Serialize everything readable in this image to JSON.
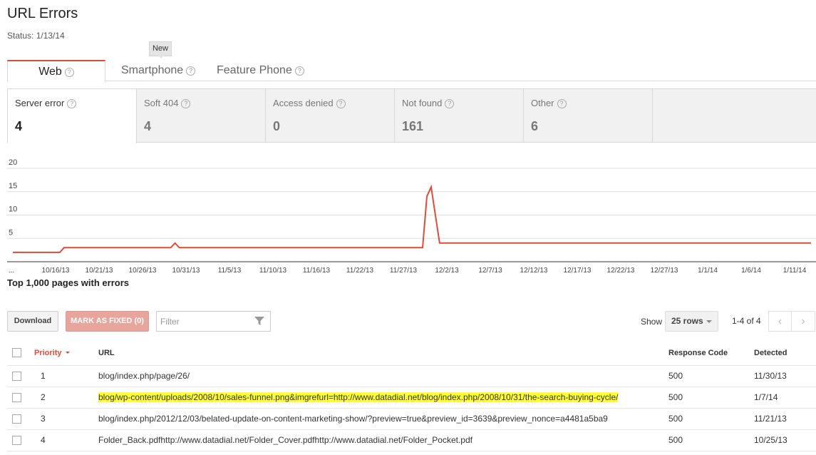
{
  "header": {
    "title": "URL Errors",
    "status": "Status: 1/13/14",
    "new_badge": "New"
  },
  "device_tabs": [
    {
      "label": "Web",
      "active": true
    },
    {
      "label": "Smartphone",
      "active": false
    },
    {
      "label": "Feature Phone",
      "active": false
    }
  ],
  "help_glyph": "?",
  "error_types": [
    {
      "label": "Server error",
      "count": "4",
      "active": true
    },
    {
      "label": "Soft 404",
      "count": "4",
      "active": false
    },
    {
      "label": "Access denied",
      "count": "0",
      "active": false
    },
    {
      "label": "Not found",
      "count": "161",
      "active": false
    },
    {
      "label": "Other",
      "count": "6",
      "active": false
    }
  ],
  "chart_data": {
    "type": "line",
    "y_ticks": [
      5,
      10,
      15,
      20
    ],
    "ylim": [
      0,
      20
    ],
    "x_tick_labels": [
      "...",
      "10/16/13",
      "10/21/13",
      "10/26/13",
      "10/31/13",
      "11/5/13",
      "11/10/13",
      "11/16/13",
      "11/22/13",
      "11/27/13",
      "12/2/13",
      "12/7/13",
      "12/12/13",
      "12/17/13",
      "12/22/13",
      "12/27/13",
      "1/1/14",
      "1/6/14",
      "1/11/14"
    ],
    "series": [
      {
        "color": "#dd4b39",
        "values": [
          2,
          2,
          2,
          2,
          2,
          2,
          2,
          2,
          2,
          2,
          2,
          2,
          3,
          3,
          3,
          3,
          3,
          3,
          3,
          3,
          3,
          3,
          3,
          3,
          3,
          3,
          3,
          3,
          3,
          3,
          3,
          3,
          3,
          3,
          3,
          3,
          3,
          3,
          4,
          3,
          3,
          3,
          3,
          3,
          3,
          3,
          3,
          3,
          3,
          3,
          3,
          3,
          3,
          3,
          3,
          3,
          3,
          3,
          3,
          3,
          3,
          3,
          3,
          3,
          3,
          3,
          3,
          3,
          3,
          3,
          3,
          3,
          3,
          3,
          3,
          3,
          3,
          3,
          3,
          3,
          3,
          3,
          3,
          3,
          3,
          3,
          3,
          3,
          3,
          3,
          3,
          3,
          3,
          3,
          3,
          3,
          3,
          14,
          16,
          10,
          4,
          4,
          4,
          4,
          4,
          4,
          4,
          4,
          4,
          4,
          4,
          4,
          4,
          4,
          4,
          4,
          4,
          4,
          4,
          4,
          4,
          4,
          4,
          4,
          4,
          4,
          4,
          4,
          4,
          4,
          4,
          4,
          4,
          4,
          4,
          4,
          4,
          4,
          4,
          4,
          4,
          4,
          4,
          4,
          4,
          4,
          4,
          4,
          4,
          4,
          4,
          4,
          4,
          4,
          4,
          4,
          4,
          4,
          4,
          4,
          4,
          4,
          4,
          4,
          4,
          4,
          4,
          4,
          4,
          4,
          4,
          4,
          4,
          4,
          4,
          4,
          4,
          4,
          4,
          4,
          4,
          4,
          4,
          4,
          4,
          4,
          4,
          4
        ]
      }
    ],
    "grid": true
  },
  "table_section": {
    "title": "Top 1,000 pages with errors"
  },
  "toolbar": {
    "download_label": "Download",
    "mark_fixed_label": "MARK AS FIXED (0)",
    "filter_placeholder": "Filter",
    "show_label": "Show",
    "rows_value": "25 rows",
    "range_label": "1-4 of 4",
    "prev_glyph": "‹",
    "next_glyph": "›"
  },
  "table": {
    "columns": {
      "priority": "Priority",
      "url": "URL",
      "response_code": "Response Code",
      "detected": "Detected"
    },
    "rows": [
      {
        "priority": "1",
        "url": "blog/index.php/page/26/",
        "response_code": "500",
        "detected": "11/30/13",
        "highlighted": false
      },
      {
        "priority": "2",
        "url": "blog/wp-content/uploads/2008/10/sales-funnel.png&imgrefurl=http://www.datadial.net/blog/index.php/2008/10/31/the-search-buying-cycle/",
        "response_code": "500",
        "detected": "1/7/14",
        "highlighted": true
      },
      {
        "priority": "3",
        "url": "blog/index.php/2012/12/03/belated-update-on-content-marketing-show/?preview=true&preview_id=3639&preview_nonce=a4481a5ba9",
        "response_code": "500",
        "detected": "11/21/13",
        "highlighted": false
      },
      {
        "priority": "4",
        "url": "Folder_Back.pdfhttp://www.datadial.net/Folder_Cover.pdfhttp://www.datadial.net/Folder_Pocket.pdf",
        "response_code": "500",
        "detected": "10/25/13",
        "highlighted": false
      }
    ]
  },
  "colors": {
    "accent": "#dd4b39",
    "highlight": "#ffff33"
  }
}
